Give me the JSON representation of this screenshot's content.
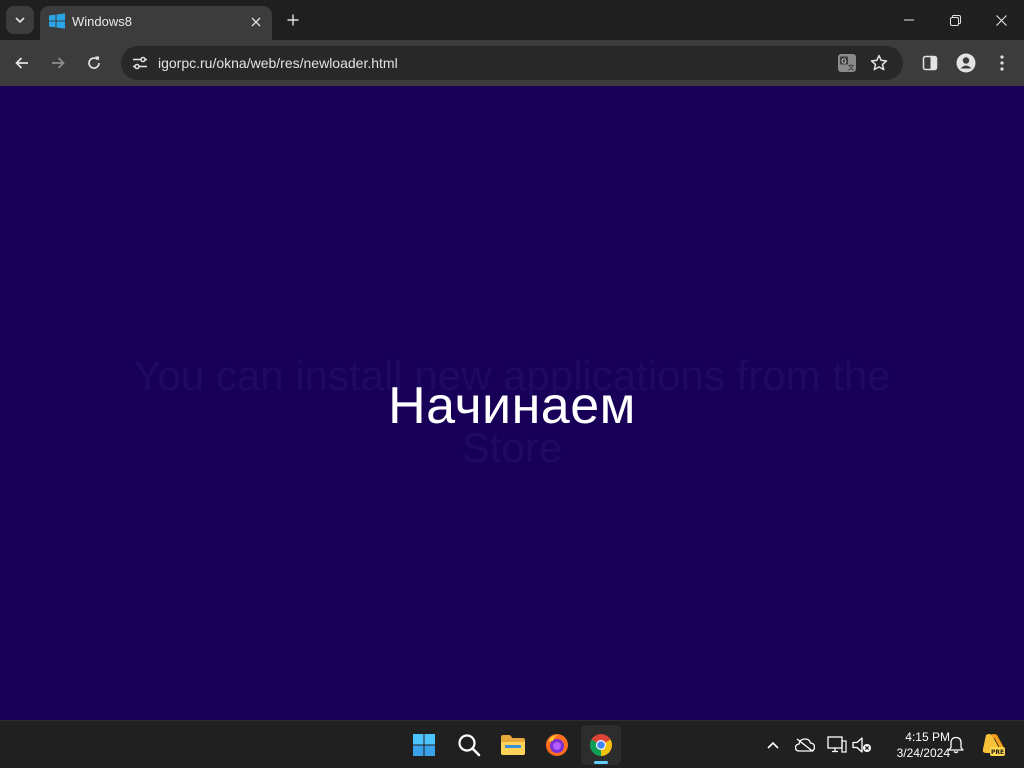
{
  "browser": {
    "tab_title": "Windows8",
    "url": "igorpc.ru/okna/web/res/newloader.html"
  },
  "page": {
    "title": "Начинаем",
    "ghost_line_1": "You can install new applications from the",
    "ghost_line_2": "Store"
  },
  "taskbar": {
    "time": "4:15 PM",
    "date": "3/24/2024",
    "apps": [
      "start",
      "search",
      "file-explorer",
      "firefox",
      "chrome"
    ],
    "active_app": "chrome"
  },
  "colors": {
    "page_bg": "#180059",
    "accent": "#60cdff",
    "chrome_dark": "#1f1f1f",
    "toolbar": "#3c3c3c"
  }
}
